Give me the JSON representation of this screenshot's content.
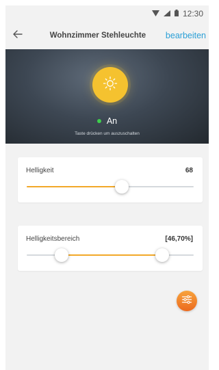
{
  "status_bar": {
    "time": "12:30",
    "icons": [
      "wifi-icon",
      "signal-icon",
      "battery-icon"
    ]
  },
  "app_bar": {
    "back_icon": "arrow-left-icon",
    "title": "Wohnzimmer Stehleuchte",
    "edit_label": "bearbeiten"
  },
  "hero": {
    "lamp_icon": "sun-icon",
    "state_label": "An",
    "hint": "Taste drücken um auszuschalten"
  },
  "brightness": {
    "label": "Helligkeit",
    "value": "68",
    "slider_value": 0.57
  },
  "brightness_range": {
    "label": "Helligkeitsbereich",
    "value": "[46,70%]",
    "range_low": 0.21,
    "range_high": 0.81
  },
  "fab": {
    "icon": "sliders-icon"
  },
  "colors": {
    "accent": "#f2a828",
    "lamp": "#f5c22f",
    "link": "#2a9fd6",
    "status_on": "#3ecf4c",
    "fab_top": "#f7a33d",
    "fab_bottom": "#ec6a1e"
  }
}
